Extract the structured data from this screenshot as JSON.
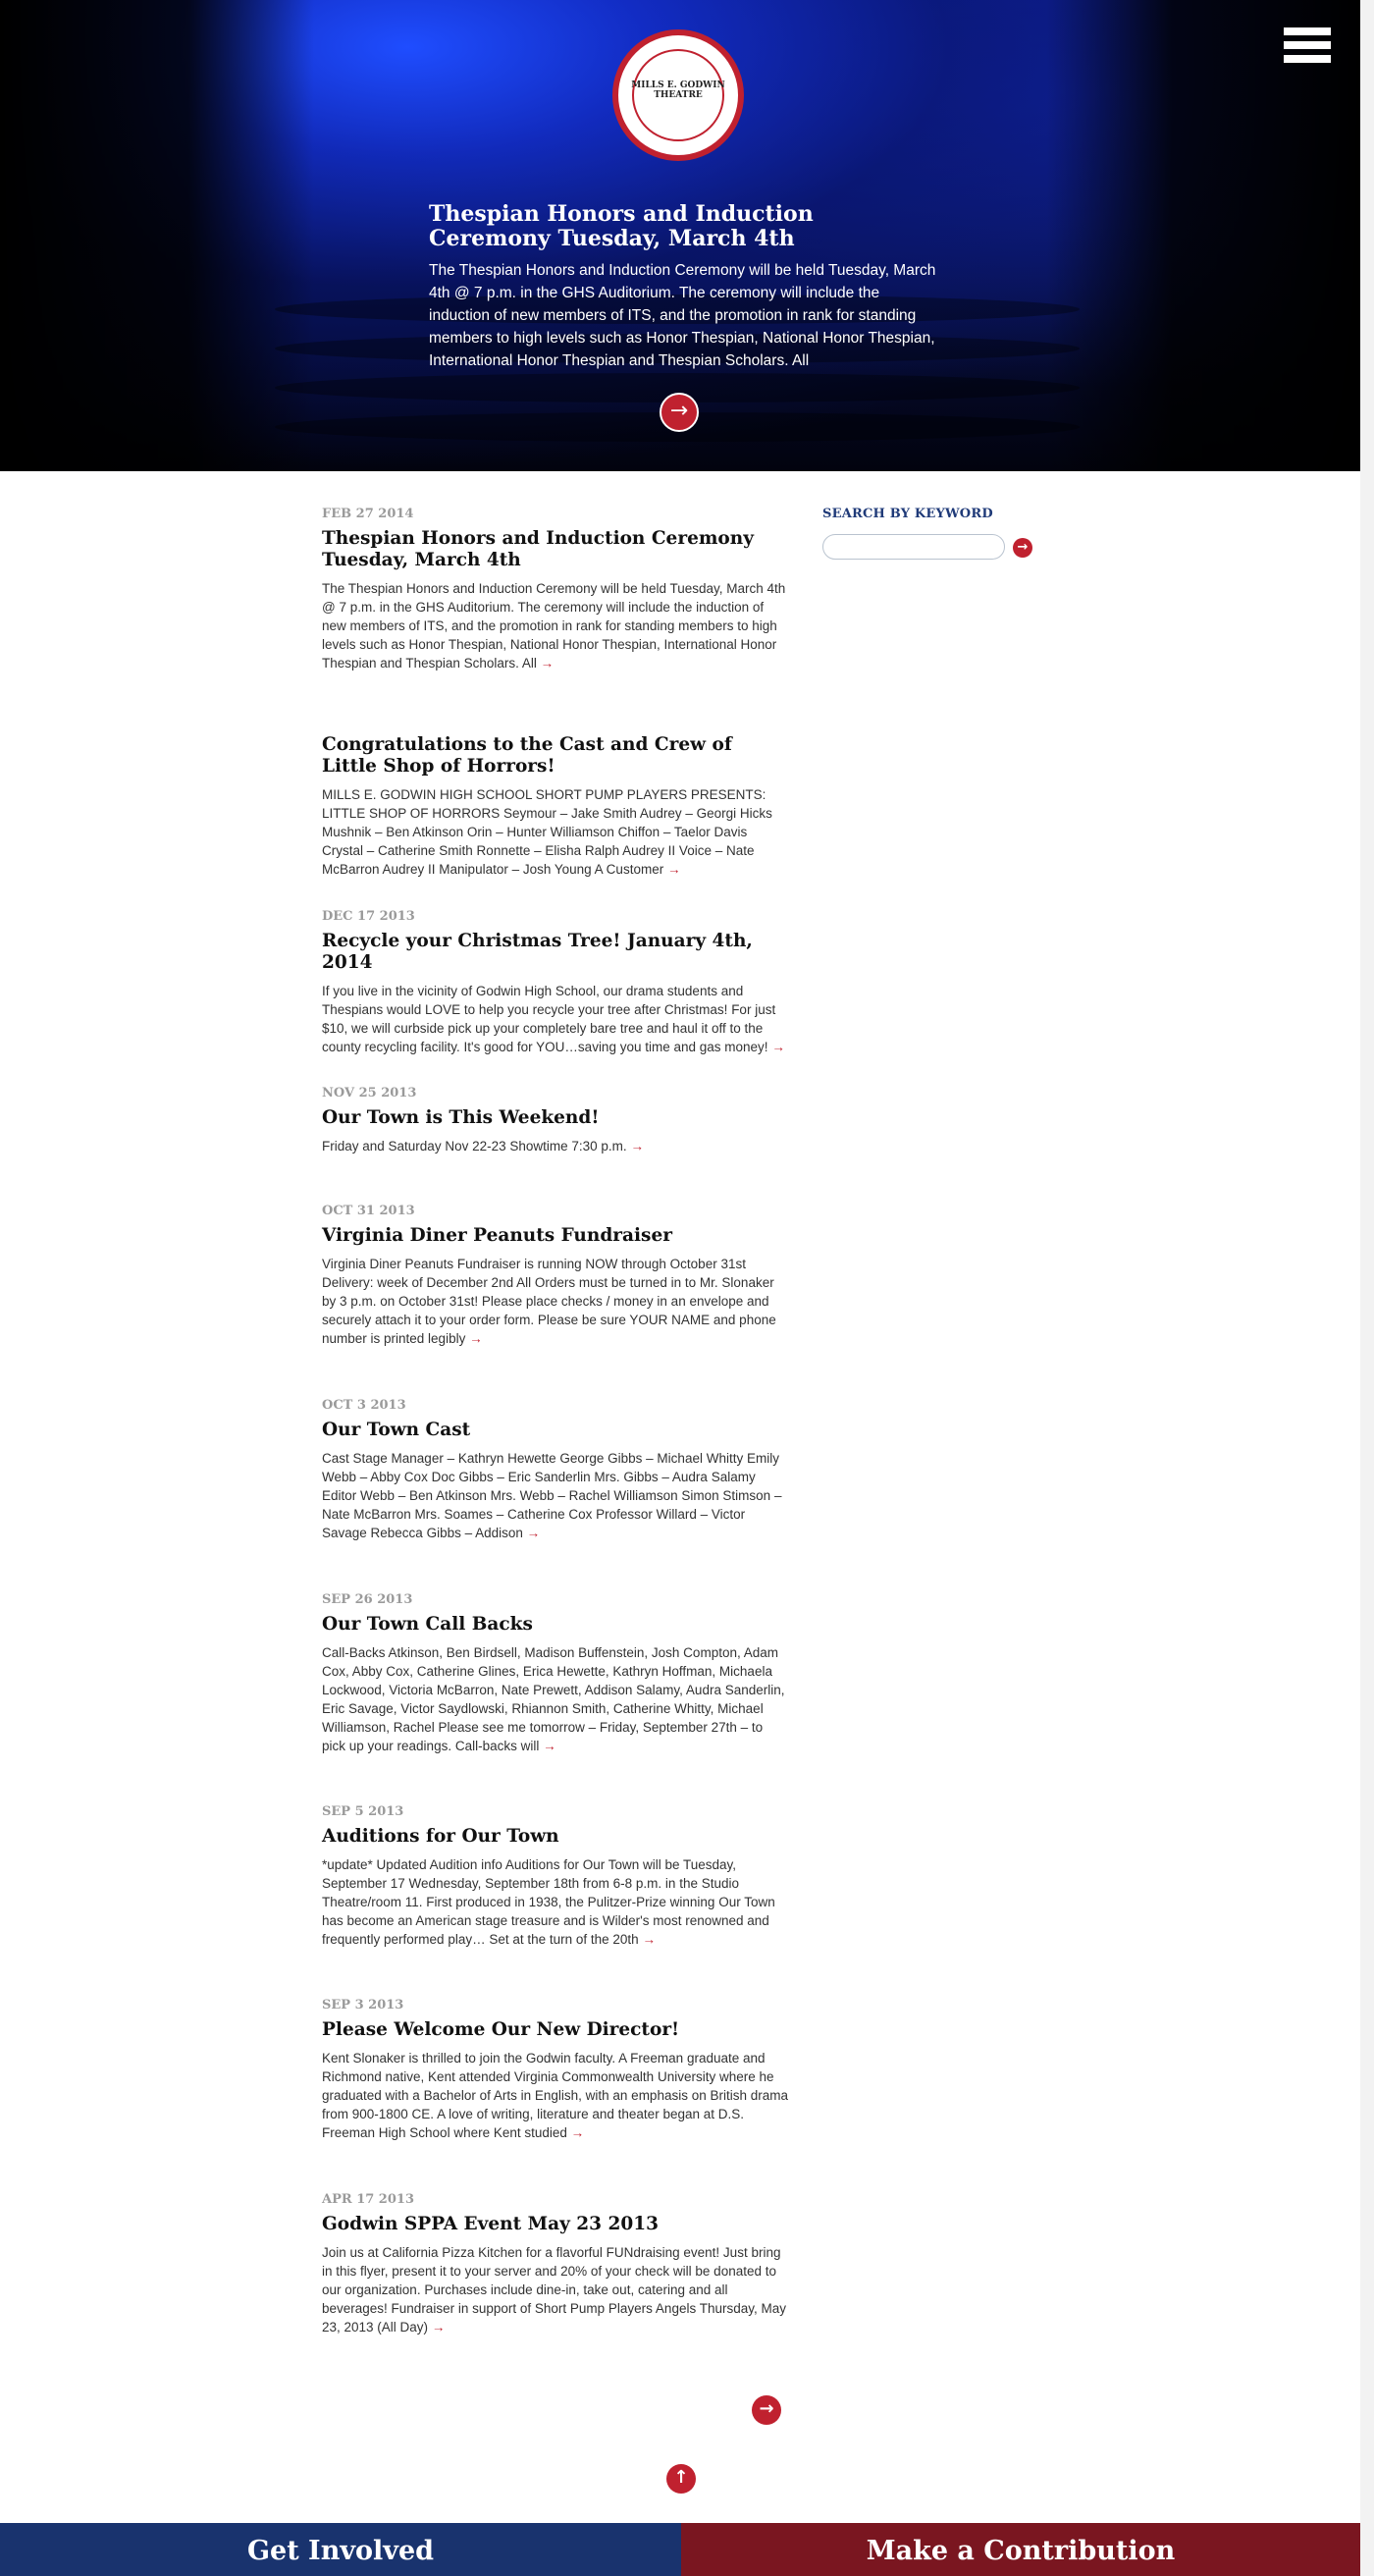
{
  "hero": {
    "logo_text": "MILLS E. GODWIN THEATRE",
    "title": "Thespian Honors and Induction Ceremony Tuesday, March 4th",
    "body": "The Thespian Honors and Induction Ceremony will be held Tuesday, March 4th @ 7 p.m. in the GHS Auditorium. The ceremony will include the induction of new members of ITS, and the promotion in rank for standing members to high levels such as Honor Thespian, National Honor Thespian, International Honor Thespian and Thespian Scholars. All",
    "arrow": "→"
  },
  "menu": {
    "icon": "hamburger-menu-icon"
  },
  "sidebar": {
    "search_label": "SEARCH BY KEYWORD",
    "search_placeholder": "",
    "search_arrow": "→"
  },
  "posts": [
    {
      "date": "FEB 27 2014",
      "title": "Thespian Honors and Induction Ceremony Tuesday, March 4th",
      "body": "The Thespian Honors and Induction Ceremony will be held Tuesday, March 4th @ 7 p.m. in the GHS Auditorium. The ceremony will include the induction of new members of ITS, and the promotion in rank for standing members to high levels such as Honor Thespian, National Honor Thespian, International Honor Thespian and Thespian Scholars. All",
      "arrow": "→"
    },
    {
      "date": "",
      "title": "Congratulations to the Cast and Crew of Little Shop of Horrors!",
      "body": "MILLS E. GODWIN HIGH SCHOOL SHORT PUMP PLAYERS PRESENTS: LITTLE SHOP OF HORRORS Seymour – Jake Smith Audrey – Georgi Hicks Mushnik – Ben Atkinson Orin – Hunter Williamson Chiffon – Taelor Davis Crystal – Catherine Smith Ronnette – Elisha Ralph Audrey II Voice – Nate McBarron Audrey II Manipulator – Josh Young A Customer",
      "arrow": "→"
    },
    {
      "date": "DEC 17 2013",
      "title": "Recycle your Christmas Tree! January 4th, 2014",
      "body": "If you live in the vicinity of Godwin High School, our drama students and Thespians would LOVE to help you recycle your tree after Christmas! For just $10, we will curbside pick up your completely bare tree and haul it off to the county recycling facility. It's good for YOU…saving you time and gas money!",
      "arrow": "→"
    },
    {
      "date": "NOV 25 2013",
      "title": "Our Town is This Weekend!",
      "body": "Friday and Saturday Nov 22-23 Showtime 7:30 p.m.",
      "arrow": "→"
    },
    {
      "date": "OCT 31 2013",
      "title": "Virginia Diner Peanuts Fundraiser",
      "body": "Virginia Diner Peanuts Fundraiser is running NOW through October 31st Delivery: week of December 2nd All Orders must be turned in to Mr. Slonaker by 3 p.m. on October 31st! Please place checks / money in an envelope and securely attach it to your order form. Please be sure YOUR NAME and phone number is printed legibly",
      "arrow": "→"
    },
    {
      "date": "OCT 3 2013",
      "title": "Our Town Cast",
      "body": "Cast Stage Manager – Kathryn Hewette George Gibbs – Michael Whitty Emily Webb – Abby Cox Doc Gibbs – Eric Sanderlin Mrs. Gibbs – Audra Salamy Editor Webb – Ben Atkinson Mrs. Webb – Rachel Williamson Simon Stimson – Nate McBarron Mrs. Soames – Catherine Cox Professor Willard – Victor Savage Rebecca Gibbs – Addison",
      "arrow": "→"
    },
    {
      "date": "SEP 26 2013",
      "title": "Our Town Call Backs",
      "body": "Call-Backs Atkinson, Ben Birdsell, Madison Buffenstein, Josh Compton, Adam Cox, Abby Cox, Catherine Glines, Erica Hewette, Kathryn Hoffman, Michaela Lockwood, Victoria McBarron, Nate Prewett, Addison Salamy, Audra Sanderlin, Eric Savage, Victor Saydlowski, Rhiannon Smith, Catherine Whitty, Michael Williamson, Rachel Please see me tomorrow – Friday, September 27th – to pick up your readings. Call-backs will",
      "arrow": "→"
    },
    {
      "date": "SEP 5 2013",
      "title": "Auditions for Our Town",
      "body": "*update* Updated Audition info Auditions for Our Town will be Tuesday, September 17 Wednesday, September 18th from 6-8 p.m. in the Studio Theatre/room 11. First produced in 1938, the Pulitzer-Prize winning Our Town has become an American stage treasure and is Wilder's most renowned and frequently performed play… Set at the turn of the 20th",
      "arrow": "→"
    },
    {
      "date": "SEP 3 2013",
      "title": "Please Welcome Our New Director!",
      "body": "Kent Slonaker is thrilled to join the Godwin faculty. A Freeman graduate and Richmond native, Kent attended Virginia Commonwealth University where he graduated with a Bachelor of Arts in English, with an emphasis on British drama from 900-1800 CE. A love of writing, literature and theater began at D.S. Freeman High School where Kent studied",
      "arrow": "→"
    },
    {
      "date": "APR 17 2013",
      "title": "Godwin SPPA Event May 23 2013",
      "body": "Join us at California Pizza Kitchen for a flavorful FUNdraising event! Just bring in this flyer, present it to your server and 20% of your check will be donated to our organization. Purchases include dine-in, take out, catering and all beverages! Fundraiser in support of Short Pump Players Angels Thursday, May 23, 2013 (All Day)",
      "arrow": "→"
    }
  ],
  "pagination": {
    "next": "→",
    "top": "↑"
  },
  "footer": {
    "left": "Get Involved",
    "right": "Make a Contribution"
  },
  "colors": {
    "accent": "#c0212f",
    "navy": "#19336e",
    "maroon": "#7a1620"
  }
}
